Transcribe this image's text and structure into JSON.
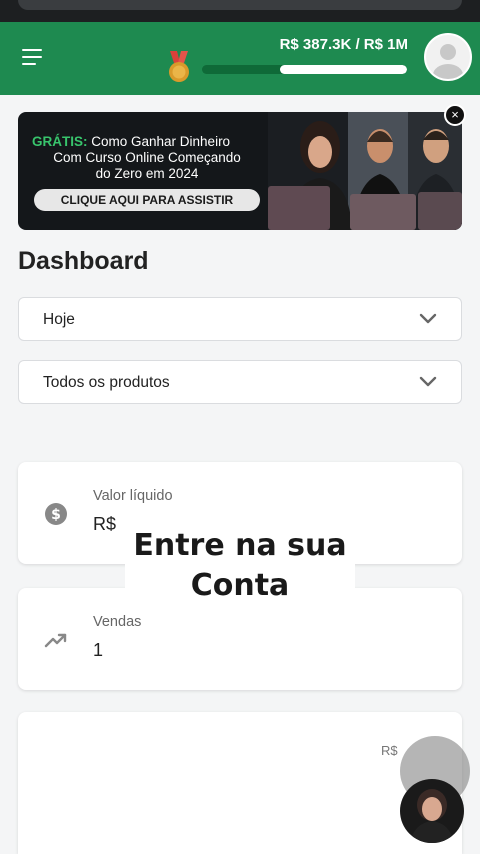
{
  "header": {
    "progress_text": "R$ 387.3K / R$ 1M",
    "progress_fraction": 0.62,
    "accent_color": "#1e8a50",
    "menu_icon": "hamburger-icon",
    "medal_icon": "medal-icon",
    "avatar_icon": "user-avatar-icon"
  },
  "banner": {
    "highlight": "GRÁTIS:",
    "line1_rest": " Como Ganhar Dinheiro",
    "line2": "Com Curso Online Começando",
    "line3": "do Zero em 2024",
    "cta": "CLIQUE AQUI PARA ASSISTIR",
    "close_icon": "close-icon",
    "close_glyph": "×"
  },
  "dashboard": {
    "title": "Dashboard",
    "period_select": "Hoje",
    "product_select": "Todos os produtos"
  },
  "cards": {
    "net_value_label": "Valor líquido",
    "net_value": "R$",
    "sales_label": "Vendas",
    "sales_value": "1",
    "third_card_value": "R$"
  },
  "overlay": {
    "line1": "Entre na sua",
    "line2": "Conta"
  }
}
